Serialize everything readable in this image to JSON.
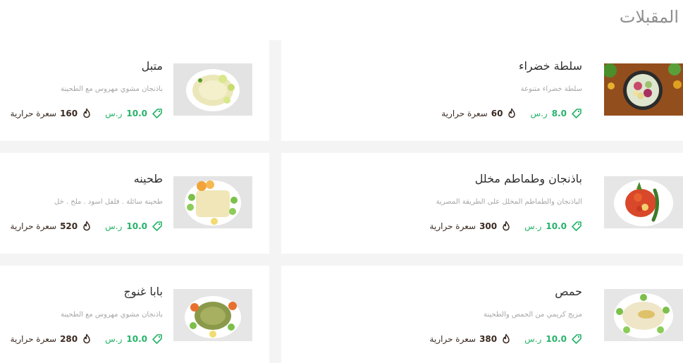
{
  "section": {
    "title": "المقبلات"
  },
  "currency": "ر.س",
  "calorie_label": "سعرة حرارية",
  "colors": {
    "price": "#26b36a",
    "calories": "#3a2a22",
    "title": "#8f8f8f"
  },
  "items": [
    {
      "name": "سلطة خضراء",
      "desc": "سلطة خضراء متنوعة",
      "price": "8.0",
      "calories": "60",
      "image": "green-salad-photo"
    },
    {
      "name": "متبل",
      "desc": "باذنجان مشوي مهروس مع الطحينة",
      "price": "10.0",
      "calories": "160",
      "image": "mutabal-photo"
    },
    {
      "name": "باذنجان وطماطم مخلل",
      "desc": "الباذنجان والطماطم المخلل على الطريقة المصرية",
      "price": "10.0",
      "calories": "300",
      "image": "pickled-eggplant-photo"
    },
    {
      "name": "طحينه",
      "desc": "طحينة سائلة . فلفل اسود . ملح . خل",
      "price": "10.0",
      "calories": "520",
      "image": "tahini-photo"
    },
    {
      "name": "حمص",
      "desc": "مزيج كريمي من الحمص والطحينة",
      "price": "10.0",
      "calories": "380",
      "image": "hummus-photo"
    },
    {
      "name": "بابا غنوج",
      "desc": "باذنجان مشوي مهروس مع الطحينة",
      "price": "10.0",
      "calories": "280",
      "image": "baba-ghanoush-photo"
    }
  ]
}
